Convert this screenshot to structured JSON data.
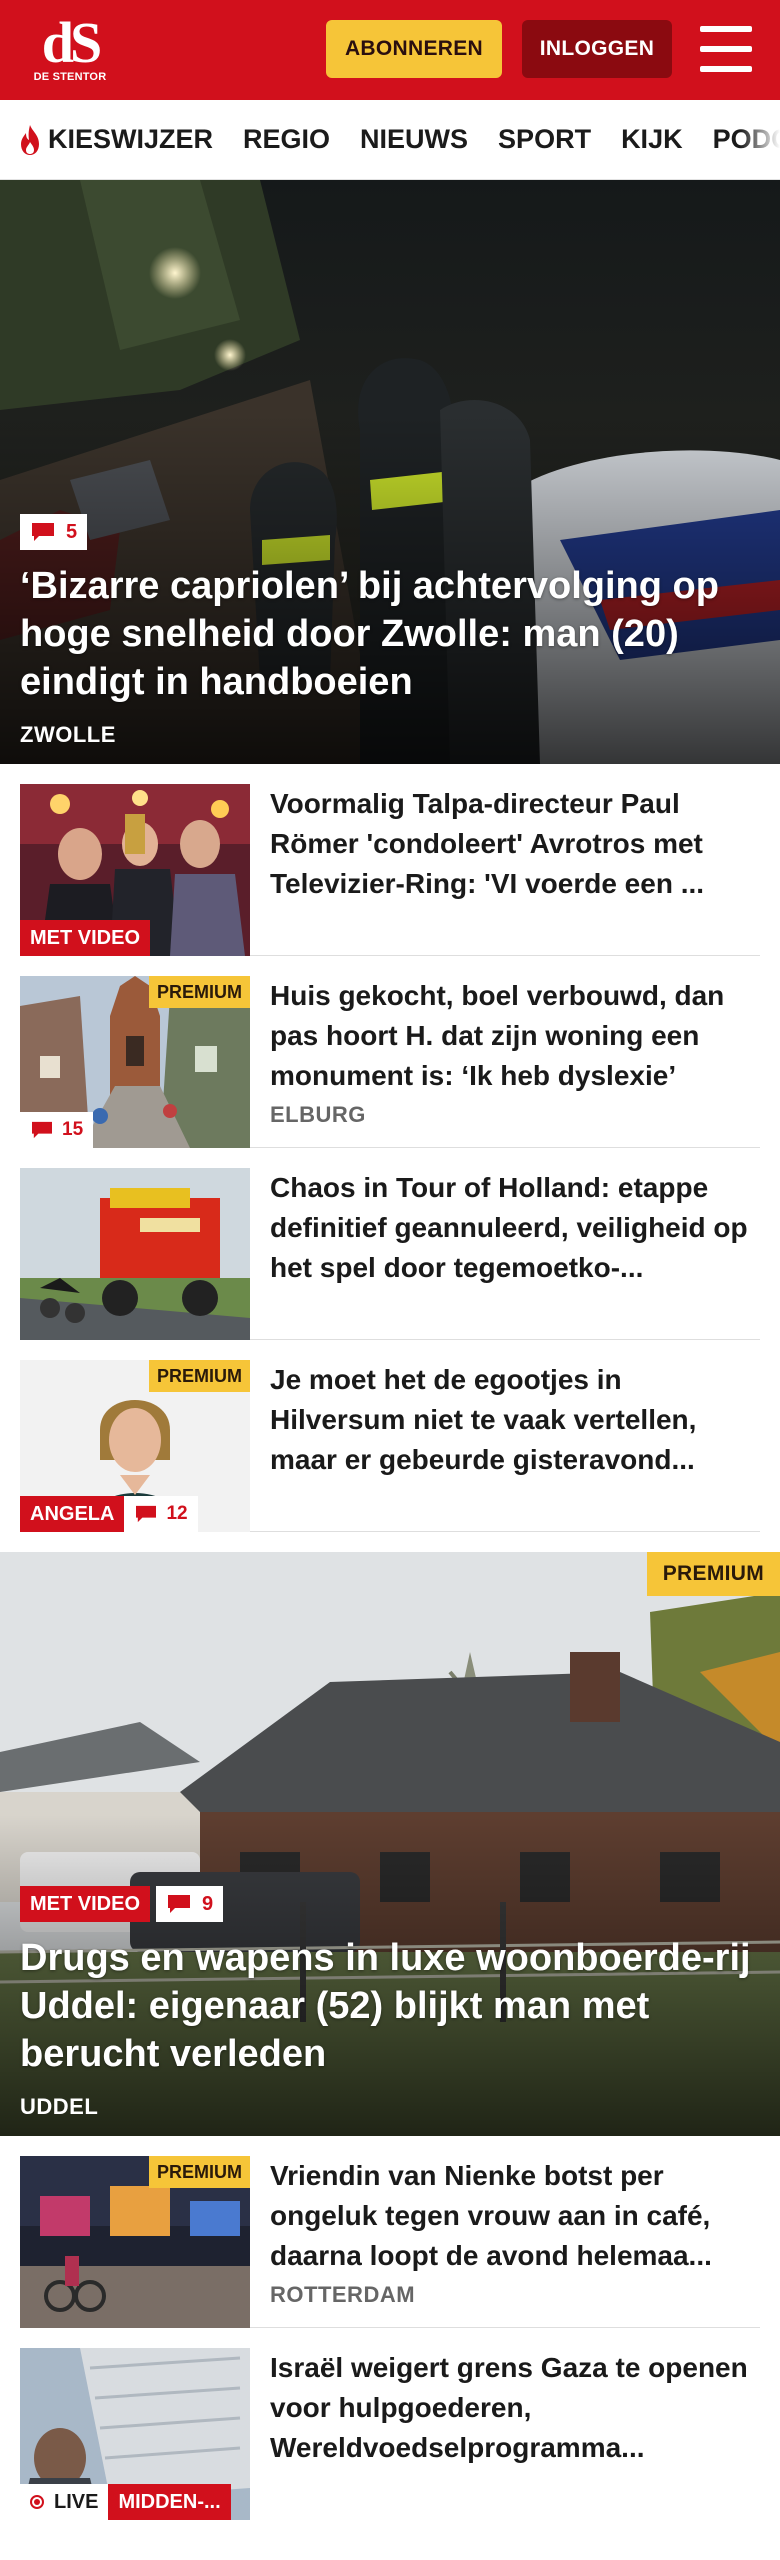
{
  "brand": {
    "logo_mark": "dS",
    "logo_sub": "DE STENTOR"
  },
  "header": {
    "subscribe_label": "ABONNEREN",
    "login_label": "INLOGGEN"
  },
  "nav": {
    "items": [
      "KIESWIJZER",
      "REGIO",
      "NIEUWS",
      "SPORT",
      "KIJK",
      "PODCAST"
    ]
  },
  "hero1": {
    "comments": "5",
    "title": "‘Bizarre capriolen’ bij achtervolging op hoge snelheid door Zwolle: man (20) eindigt in handboeien",
    "location": "ZWOLLE"
  },
  "list1": [
    {
      "title": "Voormalig Talpa-directeur Paul Römer 'condoleert' Avrotros met Televizier-Ring: 'VI voerde een ...",
      "badge": "MET VIDEO"
    },
    {
      "title": "Huis gekocht, boel verbouwd, dan pas hoort H. dat zijn woning een monument is: ‘Ik heb dyslexie’",
      "location": "ELBURG",
      "premium": "PREMIUM",
      "comments": "15"
    },
    {
      "title": "Chaos in Tour of Holland: etappe definitief geannuleerd, veiligheid op het spel door tegemoetko-..."
    },
    {
      "title": "Je moet het de egootjes in Hilversum niet te vaak vertellen, maar er gebeurde gisteravond...",
      "premium": "PREMIUM",
      "badge": "ANGELA",
      "comments": "12"
    }
  ],
  "hero2": {
    "premium": "PREMIUM",
    "badge": "MET VIDEO",
    "comments": "9",
    "title": "Drugs en wapens in luxe woonboerde-rij Uddel: eigenaar (52) blijkt man met berucht verleden",
    "location": "UDDEL"
  },
  "list2": [
    {
      "title": "Vriendin van Nienke botst per ongeluk tegen vrouw aan in café, daarna loopt de avond helemaa...",
      "location": "ROTTERDAM",
      "premium": "PREMIUM"
    },
    {
      "title": "Israël weigert grens Gaza te openen voor hulpgoederen, Wereldvoedselprogramma...",
      "live": "LIVE",
      "badge": "MIDDEN-..."
    }
  ],
  "colors": {
    "brand_red": "#d1101c",
    "premium_yellow": "#f6c538",
    "login_dark_red": "#8b0a10"
  },
  "icons": [
    "flame-icon",
    "comment-icon",
    "menu-icon",
    "live-icon"
  ]
}
